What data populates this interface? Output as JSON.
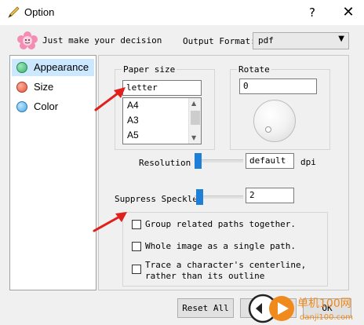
{
  "window": {
    "title": "Option",
    "help_label": "?",
    "close_label": "✕"
  },
  "header": {
    "decision_text": "Just make your decision",
    "output_format_label": "Output Format:",
    "output_format_value": "pdf"
  },
  "sidebar": {
    "items": [
      {
        "label": "Appearance",
        "color": "#3cb371",
        "selected": true
      },
      {
        "label": "Size",
        "color": "#e8553a",
        "selected": false
      },
      {
        "label": "Color",
        "color": "#4aa8e8",
        "selected": false
      }
    ]
  },
  "appearance": {
    "paper_size": {
      "title": "Paper size",
      "value": "letter",
      "options": [
        "A4",
        "A3",
        "A5"
      ]
    },
    "rotate": {
      "title": "Rotate",
      "value": "0"
    },
    "resolution": {
      "label": "Resolution",
      "value": "default",
      "unit": "dpi"
    },
    "suppress_speckle": {
      "label": "Suppress Speckle:",
      "value": "2"
    },
    "options": [
      {
        "label": "Group related paths together.",
        "checked": false
      },
      {
        "label": "Whole image as a single path.",
        "checked": false
      },
      {
        "label_line1": "Trace a character's centerline,",
        "label_line2": "rather than its outline",
        "checked": false
      }
    ]
  },
  "footer": {
    "reset_label": "Reset All",
    "cancel_label": "Canc",
    "ok_label": "OK"
  },
  "watermark": {
    "line1": "单机100网",
    "line2": "danji100.com"
  },
  "colors": {
    "accent": "#1e7fd8",
    "selection": "#cce8ff",
    "annotation_arrow": "#e0201c"
  }
}
